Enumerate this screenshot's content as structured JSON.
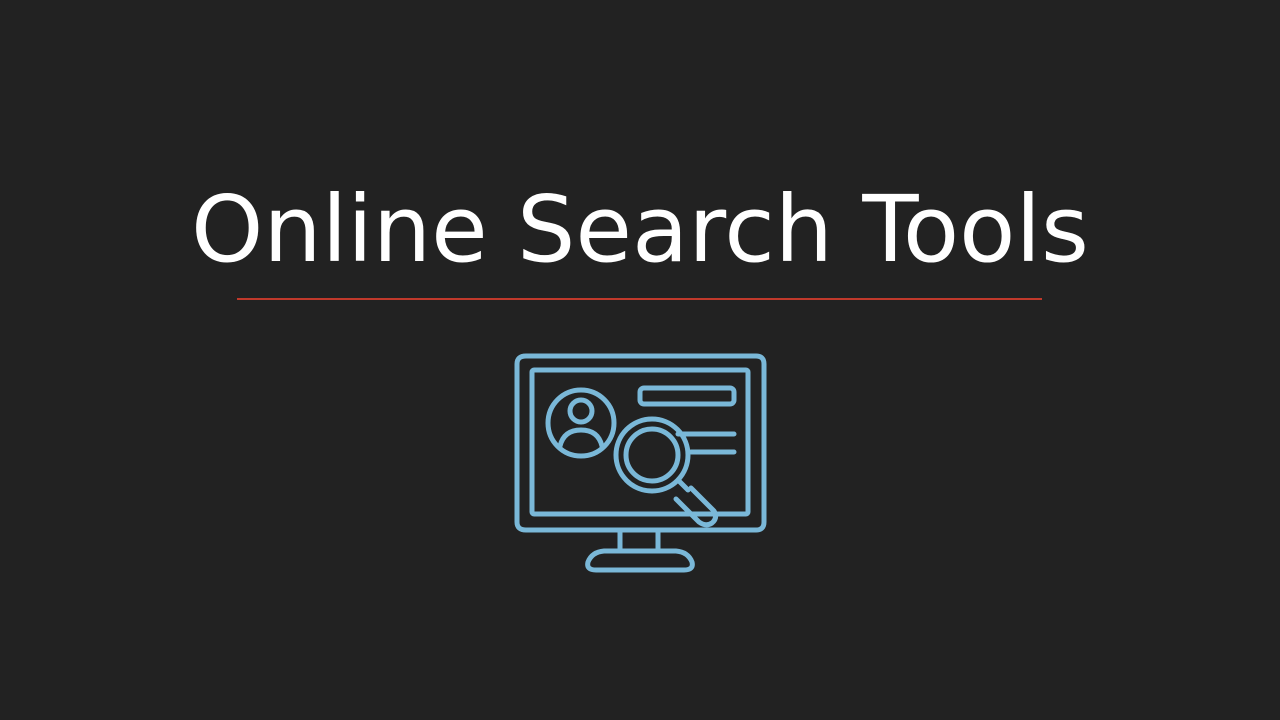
{
  "slide": {
    "title": "Online Search Tools",
    "icon": "monitor-profile-search-icon"
  },
  "colors": {
    "background": "#222222",
    "title_text": "#ffffff",
    "divider": "#c0392b",
    "icon_stroke": "#7ab8d8"
  }
}
